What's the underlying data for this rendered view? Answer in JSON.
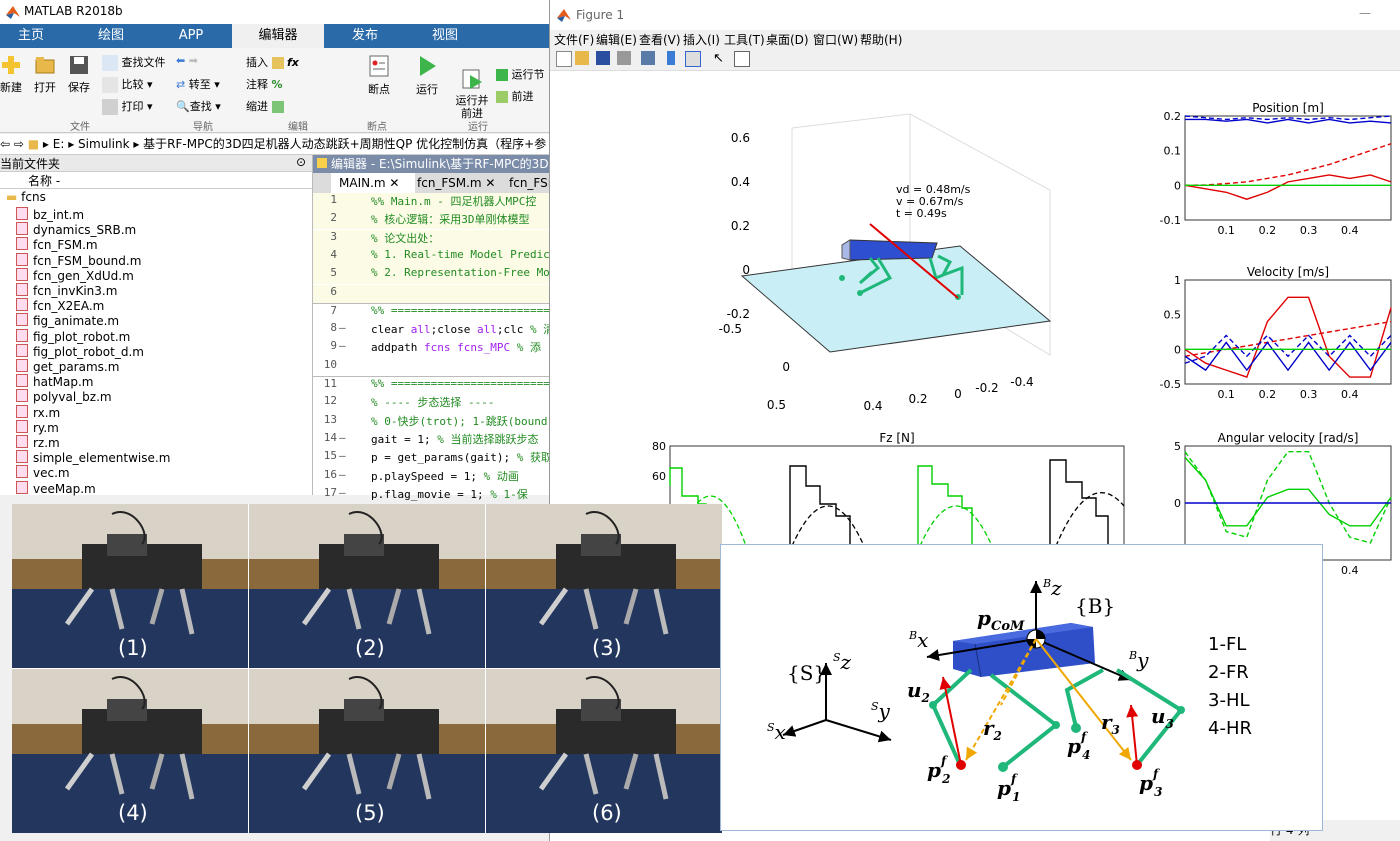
{
  "matlab": {
    "title": "MATLAB R2018b",
    "tabs": [
      "主页",
      "绘图",
      "APP",
      "编辑器",
      "发布",
      "视图"
    ],
    "active_tab": "编辑器",
    "ribbon": {
      "new": "新建",
      "open": "打开",
      "save": "保存",
      "find_files": "查找文件",
      "compare": "比较",
      "print": "打印",
      "go_to": "转至",
      "find": "查找",
      "insert": "插入",
      "comment": "注释",
      "indent": "缩进",
      "breakpoints": "断点",
      "run": "运行",
      "run_advance": "运行并\n前进",
      "run_section": "运行节",
      "advance": "前进",
      "sections": [
        "文件",
        "导航",
        "编辑",
        "断点",
        "运行"
      ]
    },
    "path": [
      "E:",
      "Simulink",
      "基于RF-MPC的3D四足机器人动态跳跃+周期性QP 优化控制仿真（程序+参"
    ],
    "current_folder_label": "当前文件夹",
    "name_column": "名称 -",
    "folder": "fcns",
    "files": [
      "bz_int.m",
      "dynamics_SRB.m",
      "fcn_FSM.m",
      "fcn_FSM_bound.m",
      "fcn_gen_XdUd.m",
      "fcn_invKin3.m",
      "fcn_X2EA.m",
      "fig_animate.m",
      "fig_plot_robot.m",
      "fig_plot_robot_d.m",
      "get_params.m",
      "hatMap.m",
      "polyval_bz.m",
      "rx.m",
      "ry.m",
      "rz.m",
      "simple_elementwise.m",
      "vec.m",
      "veeMap.m"
    ],
    "editor": {
      "title": "编辑器 - E:\\Simulink\\基于RF-MPC的3D四足",
      "tabs": [
        "MAIN.m",
        "fcn_FSM.m",
        "fcn_FSM"
      ],
      "lines": [
        {
          "n": "1",
          "d": "",
          "t": "%% Main.m - 四足机器人MPC控",
          "c": "cmt"
        },
        {
          "n": "2",
          "d": "",
          "t": "% 核心逻辑：采用3D单刚体模型",
          "c": "cmt"
        },
        {
          "n": "3",
          "d": "",
          "t": "% 论文出处：",
          "c": "cmt"
        },
        {
          "n": "4",
          "d": "",
          "t": "% 1. Real-time Model Predict",
          "c": "cmt"
        },
        {
          "n": "5",
          "d": "",
          "t": "% 2. Representation-Free Mod",
          "c": "cmt"
        },
        {
          "n": "6",
          "d": "",
          "t": "",
          "c": ""
        },
        {
          "n": "7",
          "d": "",
          "t": "%% ==========================",
          "c": "cmt"
        },
        {
          "n": "8",
          "d": "—",
          "t": "clear all;close all;clc  % 清",
          "c": "code"
        },
        {
          "n": "9",
          "d": "—",
          "t": "addpath fcns fcns_MPC    % 添",
          "c": "code"
        },
        {
          "n": "10",
          "d": "",
          "t": "",
          "c": ""
        },
        {
          "n": "11",
          "d": "",
          "t": "%% ==========================",
          "c": "cmt"
        },
        {
          "n": "12",
          "d": "",
          "t": "% ---- 步态选择 ----",
          "c": "cmt"
        },
        {
          "n": "13",
          "d": "",
          "t": "% 0-快步(trot); 1-跳跃(bound",
          "c": "cmt"
        },
        {
          "n": "14",
          "d": "—",
          "t": "gait = 1;  % 当前选择跳跃步态",
          "c": "code"
        },
        {
          "n": "15",
          "d": "—",
          "t": "p = get_params(gait);  % 获取",
          "c": "code"
        },
        {
          "n": "16",
          "d": "—",
          "t": "p.playSpeed = 1;       % 动画",
          "c": "code"
        },
        {
          "n": "17",
          "d": "—",
          "t": "p.flag_movie = 1;      % 1-保",
          "c": "code"
        }
      ]
    }
  },
  "figure": {
    "title": "Figure 1",
    "menu": [
      "文件(F)",
      "编辑(E)",
      "查看(V)",
      "插入(I)",
      "工具(T)",
      "桌面(D)",
      "窗口(W)",
      "帮助(H)"
    ],
    "sim_text": [
      "vd = 0.48m/s",
      "v = 0.67m/s",
      "t = 0.49s"
    ],
    "axes3d": {
      "z_ticks": [
        "0.6",
        "0.4",
        "0.2",
        "0",
        "-0.2"
      ],
      "x_ticks": [
        "-0.5",
        "0",
        "0.5"
      ],
      "y_ticks": [
        "0.4",
        "0.2",
        "0",
        "-0.2",
        "-0.4"
      ]
    },
    "fz_title": "Fz [N]",
    "fz_ticks": [
      "80",
      "60"
    ],
    "colors": {
      "blue": "#0000cc",
      "red": "#e00000",
      "green": "#00d000",
      "black": "#000000",
      "ground": "#c9eef6",
      "body": "#2e4fd0",
      "legs": "#1fb87a"
    }
  },
  "chart_data": [
    {
      "type": "line",
      "title": "Position [m]",
      "xlabel": "",
      "ylabel": "",
      "xlim": [
        0,
        0.5
      ],
      "ylim": [
        -0.1,
        0.2
      ],
      "x_ticks": [
        "0.1",
        "0.2",
        "0.3",
        "0.4"
      ],
      "y_ticks": [
        "0.2",
        "0.1",
        "0",
        "-0.1"
      ],
      "x": [
        0.0,
        0.05,
        0.1,
        0.15,
        0.2,
        0.25,
        0.3,
        0.35,
        0.4,
        0.45,
        0.5
      ],
      "series": [
        {
          "color": "#e00000",
          "style": "solid",
          "values": [
            0.0,
            -0.01,
            -0.02,
            -0.04,
            -0.02,
            0.01,
            0.02,
            0.03,
            0.02,
            0.03,
            0.01
          ]
        },
        {
          "color": "#e00000",
          "style": "dashed",
          "values": [
            0.0,
            0.001,
            0.005,
            0.01,
            0.02,
            0.03,
            0.045,
            0.06,
            0.08,
            0.1,
            0.12
          ]
        },
        {
          "color": "#0000cc",
          "style": "solid",
          "values": [
            0.19,
            0.19,
            0.185,
            0.19,
            0.18,
            0.19,
            0.18,
            0.19,
            0.18,
            0.185,
            0.18
          ]
        },
        {
          "color": "#0000cc",
          "style": "dashed",
          "values": [
            0.2,
            0.195,
            0.19,
            0.195,
            0.19,
            0.195,
            0.19,
            0.195,
            0.19,
            0.195,
            0.2
          ]
        },
        {
          "color": "#00d000",
          "style": "solid",
          "values": [
            0,
            0,
            0,
            0,
            0,
            0,
            0,
            0,
            0,
            0,
            0
          ]
        }
      ]
    },
    {
      "type": "line",
      "title": "Velocity [m/s]",
      "xlabel": "",
      "ylabel": "",
      "xlim": [
        0,
        0.5
      ],
      "ylim": [
        -0.5,
        1
      ],
      "x_ticks": [
        "0.1",
        "0.2",
        "0.3",
        "0.4"
      ],
      "y_ticks": [
        "1",
        "0.5",
        "0",
        "-0.5"
      ],
      "x": [
        0.0,
        0.05,
        0.1,
        0.15,
        0.2,
        0.25,
        0.3,
        0.35,
        0.4,
        0.45,
        0.5
      ],
      "series": [
        {
          "color": "#e00000",
          "style": "solid",
          "values": [
            0.0,
            -0.2,
            -0.3,
            -0.4,
            0.4,
            0.75,
            0.75,
            -0.1,
            -0.4,
            -0.4,
            0.6
          ]
        },
        {
          "color": "#e00000",
          "style": "dashed",
          "values": [
            -0.1,
            -0.05,
            0.0,
            0.05,
            0.1,
            0.15,
            0.2,
            0.25,
            0.3,
            0.35,
            0.4
          ]
        },
        {
          "color": "#0000cc",
          "style": "solid",
          "values": [
            -0.1,
            -0.3,
            0.1,
            -0.3,
            0.1,
            -0.3,
            0.1,
            -0.3,
            0.1,
            -0.3,
            0.1
          ]
        },
        {
          "color": "#0000cc",
          "style": "dashed",
          "values": [
            -0.2,
            -0.1,
            0.2,
            -0.1,
            0.2,
            -0.1,
            0.2,
            -0.1,
            0.2,
            -0.1,
            0.2
          ]
        },
        {
          "color": "#00d000",
          "style": "solid",
          "values": [
            0,
            0,
            0,
            0,
            0,
            0,
            0,
            0,
            0,
            0,
            0
          ]
        }
      ]
    },
    {
      "type": "line",
      "title": "Angular velocity [rad/s]",
      "xlabel": "",
      "ylabel": "",
      "xlim": [
        0,
        0.5
      ],
      "ylim": [
        -5,
        5
      ],
      "x_ticks": [
        "0.4"
      ],
      "y_ticks": [
        "5",
        "0"
      ],
      "x": [
        0.0,
        0.05,
        0.1,
        0.15,
        0.2,
        0.25,
        0.3,
        0.35,
        0.4,
        0.45,
        0.5
      ],
      "series": [
        {
          "color": "#00d000",
          "style": "solid",
          "values": [
            4.0,
            2.0,
            -2.0,
            -2.0,
            0.5,
            1.2,
            1.2,
            -1.0,
            -2.0,
            -2.0,
            0.5
          ]
        },
        {
          "color": "#00d000",
          "style": "dashed",
          "values": [
            4.5,
            2.0,
            -2.5,
            -3.0,
            2.0,
            4.5,
            4.5,
            0.0,
            -3.0,
            -3.5,
            0.5
          ]
        },
        {
          "color": "#0000cc",
          "style": "solid",
          "values": [
            0,
            0,
            0,
            0,
            0,
            0,
            0,
            0,
            0,
            0,
            0
          ]
        }
      ]
    },
    {
      "type": "bar",
      "title": "Fz [N]",
      "xlabel": "",
      "ylabel": "",
      "ylim": [
        0,
        80
      ],
      "y_ticks": [
        "80",
        "60"
      ],
      "series": [
        {
          "name": "",
          "color": "#00d000",
          "values": [
            55,
            68,
            68,
            40,
            45,
            40,
            30,
            20,
            10,
            5,
            0,
            0,
            0,
            0,
            0,
            0,
            0,
            0,
            0,
            0,
            0,
            0,
            0,
            0,
            0,
            0,
            0,
            0,
            0,
            0,
            0,
            0,
            0,
            0,
            0,
            0,
            0,
            0,
            0,
            0,
            0,
            0,
            0,
            0,
            0,
            0,
            0,
            0,
            0,
            0,
            0,
            0,
            0,
            0,
            0,
            0,
            0,
            0
          ]
        },
        {
          "name": "",
          "color": "#000000",
          "values": [
            0,
            0,
            0,
            0,
            0,
            0,
            0,
            0,
            0,
            0,
            0,
            0,
            0,
            0,
            0,
            0,
            0,
            0,
            0,
            0,
            0,
            0,
            0,
            0,
            0,
            0,
            0,
            0,
            0,
            0,
            0,
            0,
            0,
            0,
            0,
            0,
            0,
            0,
            0,
            0,
            0,
            0,
            0,
            0,
            0,
            0,
            0,
            0,
            0,
            0,
            0,
            0,
            0,
            0,
            0,
            0,
            0,
            0
          ]
        }
      ]
    }
  ],
  "photos": [
    "(1)",
    "(2)",
    "(3)",
    "(4)",
    "(5)",
    "(6)"
  ],
  "diagram": {
    "com": "CoM",
    "frame_B": "{B}",
    "frame_S": "{S}",
    "legend": [
      "1-FL",
      "2-FR",
      "3-HL",
      "4-HR"
    ]
  },
  "status": {
    "row": "行",
    "row_n": "4",
    "col": "列"
  }
}
